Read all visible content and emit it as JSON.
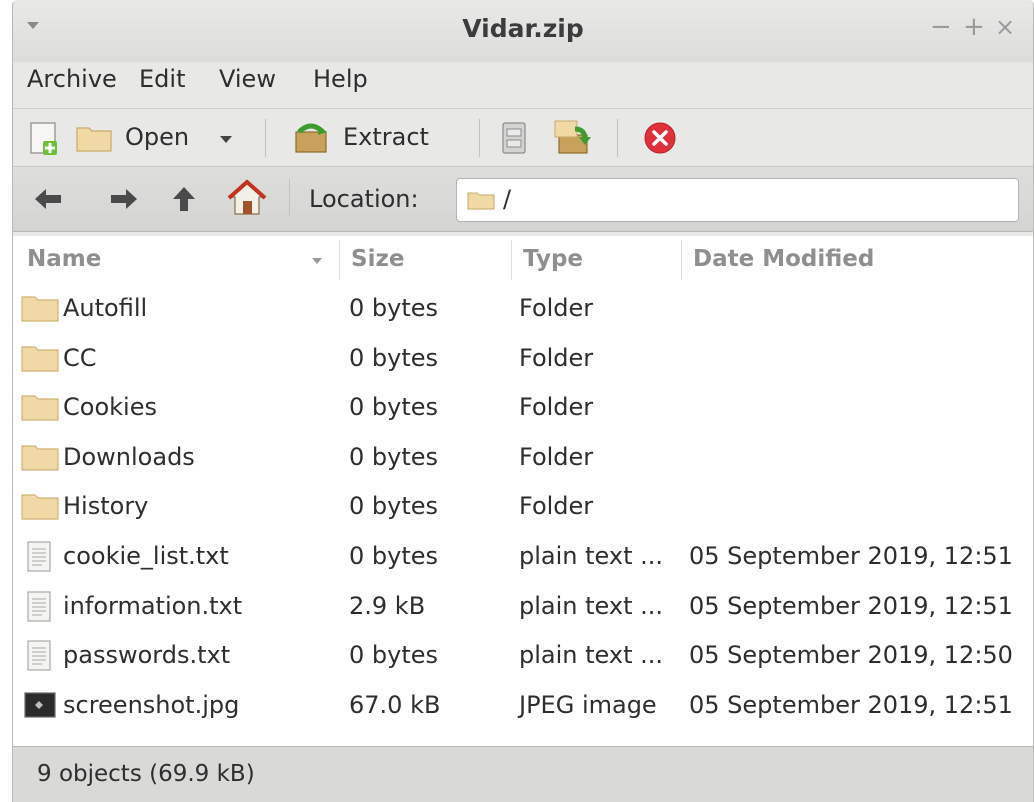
{
  "window": {
    "title": "Vidar.zip",
    "controls": [
      "−",
      "+",
      "×"
    ]
  },
  "menu": {
    "items": [
      "Archive",
      "Edit",
      "View",
      "Help"
    ]
  },
  "toolbar": {
    "open_label": "Open",
    "extract_label": "Extract"
  },
  "location": {
    "label": "Location:",
    "value": "/"
  },
  "columns": {
    "name": "Name",
    "size": "Size",
    "type": "Type",
    "date": "Date Modified"
  },
  "files": [
    {
      "name": "Autofill",
      "size": "0 bytes",
      "type": "Folder",
      "date": "",
      "icon": "folder"
    },
    {
      "name": "CC",
      "size": "0 bytes",
      "type": "Folder",
      "date": "",
      "icon": "folder"
    },
    {
      "name": "Cookies",
      "size": "0 bytes",
      "type": "Folder",
      "date": "",
      "icon": "folder"
    },
    {
      "name": "Downloads",
      "size": "0 bytes",
      "type": "Folder",
      "date": "",
      "icon": "folder"
    },
    {
      "name": "History",
      "size": "0 bytes",
      "type": "Folder",
      "date": "",
      "icon": "folder"
    },
    {
      "name": "cookie_list.txt",
      "size": "0 bytes",
      "type": "plain text ...",
      "date": "05 September 2019, 12:51",
      "icon": "text-file"
    },
    {
      "name": "information.txt",
      "size": "2.9 kB",
      "type": "plain text ...",
      "date": "05 September 2019, 12:51",
      "icon": "text-file"
    },
    {
      "name": "passwords.txt",
      "size": "0 bytes",
      "type": "plain text ...",
      "date": "05 September 2019, 12:50",
      "icon": "text-file"
    },
    {
      "name": "screenshot.jpg",
      "size": "67.0 kB",
      "type": "JPEG image",
      "date": "05 September 2019, 12:51",
      "icon": "image-file"
    }
  ],
  "status": {
    "text": "9 objects (69.9 kB)"
  },
  "colors": {
    "window_bg": "#e8e8e6",
    "folder": "#f0d9a4",
    "close_button": "#e0313b",
    "header_text": "#8f8f8f"
  }
}
